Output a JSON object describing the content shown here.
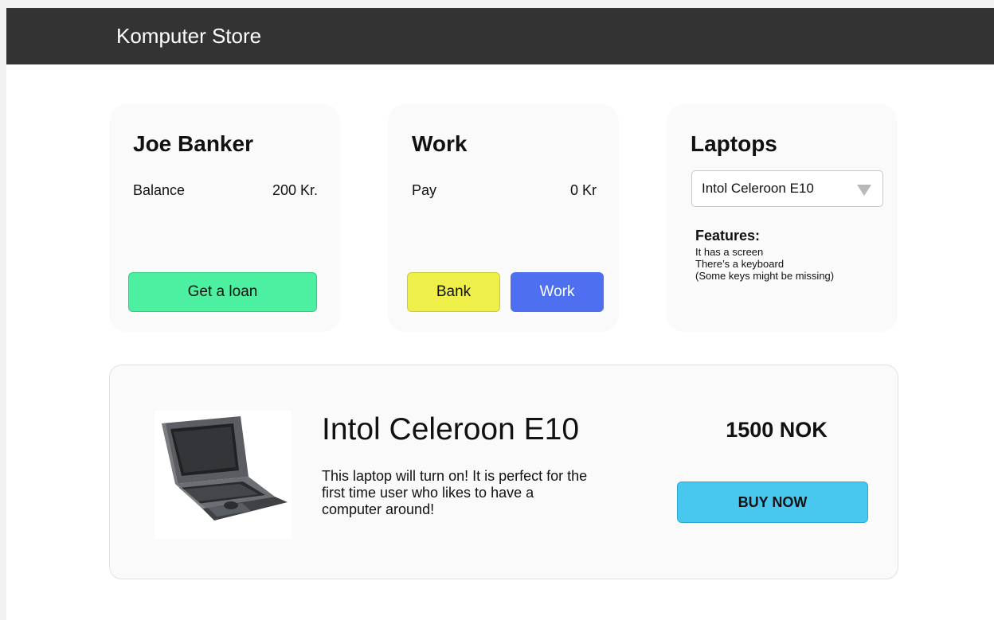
{
  "header": {
    "brand": "Komputer Store"
  },
  "bank": {
    "title": "Joe Banker",
    "balance_label": "Balance",
    "balance_value": "200 Kr.",
    "loan_button": "Get a loan"
  },
  "work": {
    "title": "Work",
    "pay_label": "Pay",
    "pay_value": "0 Kr",
    "bank_button": "Bank",
    "work_button": "Work"
  },
  "laptops": {
    "title": "Laptops",
    "selected": "Intol Celeroon E10",
    "features_title": "Features:",
    "features": [
      "It has a screen",
      "There’s a keyboard",
      "(Some keys might be missing)"
    ]
  },
  "product": {
    "name": "Intol Celeroon E10",
    "description": "This laptop will turn on! It is perfect for the first time user who likes to have a computer around!",
    "price": "1500 NOK",
    "buy_button": "BUY NOW",
    "image_icon": "laptop-image"
  },
  "colors": {
    "topbar": "#333333",
    "loan_button": "#4cf0a0",
    "bank_button": "#eef049",
    "work_button": "#4e6ff0",
    "buy_button": "#49c8ef"
  }
}
